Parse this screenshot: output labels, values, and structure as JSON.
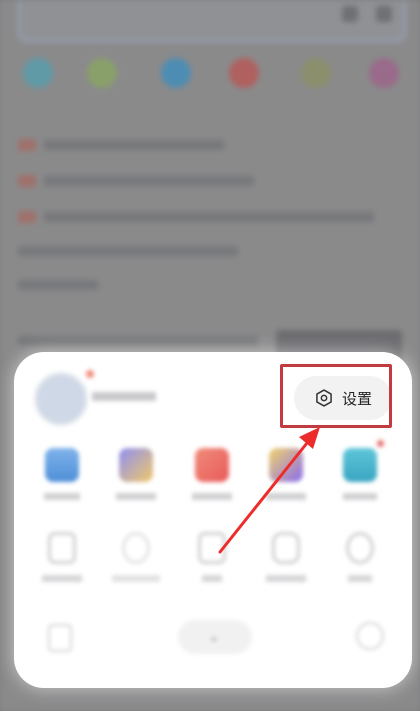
{
  "menu": {
    "settings_label": "设置"
  },
  "colors": {
    "highlight": "#c23c3f",
    "arrow": "#ee2b2b"
  },
  "icons": [
    "hexagon-settings-icon",
    "folder-icon",
    "bookmark-icon",
    "video-icon",
    "note-icon",
    "calendar-icon"
  ]
}
